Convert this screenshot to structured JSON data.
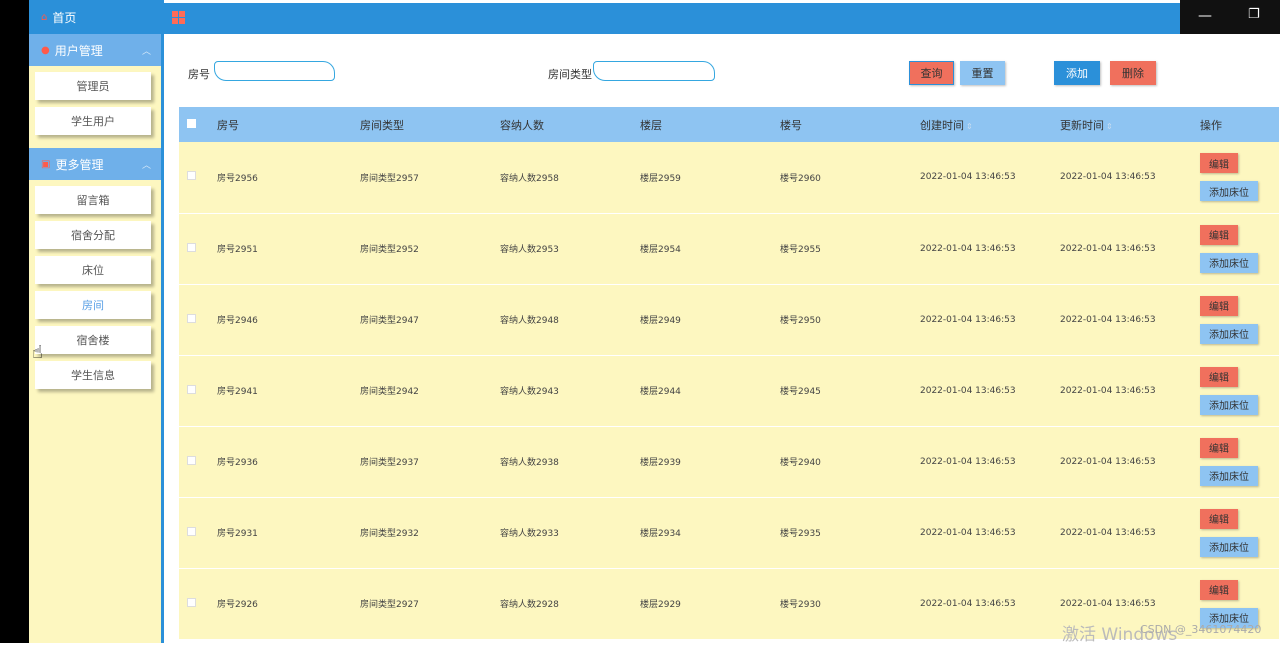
{
  "sidebar": {
    "home": "首页",
    "groups": [
      {
        "label": "用户管理",
        "items": [
          "管理员",
          "学生用户"
        ]
      },
      {
        "label": "更多管理",
        "items": [
          "留言箱",
          "宿舍分配",
          "床位",
          "房间",
          "宿舍楼",
          "学生信息"
        ]
      }
    ]
  },
  "search": {
    "room_no_label": "房号",
    "room_type_label": "房间类型",
    "room_no_value": "",
    "room_type_value": "",
    "query_label": "查询",
    "reset_label": "重置",
    "add_label": "添加",
    "delete_label": "删除"
  },
  "table": {
    "headers": [
      "房号",
      "房间类型",
      "容纳人数",
      "楼层",
      "楼号",
      "创建时间",
      "更新时间",
      "操作"
    ],
    "edit_label": "编辑",
    "add_bed_label": "添加床位",
    "rows": [
      [
        "房号2956",
        "房间类型2957",
        "容纳人数2958",
        "楼层2959",
        "楼号2960",
        "2022-01-04 13:46:53",
        "2022-01-04 13:46:53"
      ],
      [
        "房号2951",
        "房间类型2952",
        "容纳人数2953",
        "楼层2954",
        "楼号2955",
        "2022-01-04 13:46:53",
        "2022-01-04 13:46:53"
      ],
      [
        "房号2946",
        "房间类型2947",
        "容纳人数2948",
        "楼层2949",
        "楼号2950",
        "2022-01-04 13:46:53",
        "2022-01-04 13:46:53"
      ],
      [
        "房号2941",
        "房间类型2942",
        "容纳人数2943",
        "楼层2944",
        "楼号2945",
        "2022-01-04 13:46:53",
        "2022-01-04 13:46:53"
      ],
      [
        "房号2936",
        "房间类型2937",
        "容纳人数2938",
        "楼层2939",
        "楼号2940",
        "2022-01-04 13:46:53",
        "2022-01-04 13:46:53"
      ],
      [
        "房号2931",
        "房间类型2932",
        "容纳人数2933",
        "楼层2934",
        "楼号2935",
        "2022-01-04 13:46:53",
        "2022-01-04 13:46:53"
      ],
      [
        "房号2926",
        "房间类型2927",
        "容纳人数2928",
        "楼层2929",
        "楼号2930",
        "2022-01-04 13:46:53",
        "2022-01-04 13:46:53"
      ]
    ]
  },
  "watermark": {
    "activate": "激活 Windows",
    "csdn": "CSDN @_3461074420"
  },
  "colors": {
    "primary": "#2b90d9",
    "light_blue": "#8ec4f2",
    "cream": "#fdf7c0",
    "red": "#f0705d"
  },
  "icons": {
    "home": "home-icon",
    "user": "user-icon",
    "more": "box-icon",
    "menu": "grid-icon"
  }
}
